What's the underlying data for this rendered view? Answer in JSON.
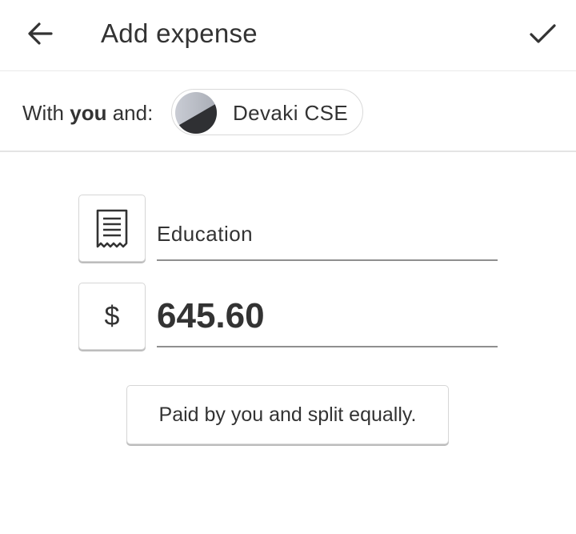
{
  "header": {
    "title": "Add expense",
    "back_icon": "arrow-left-icon",
    "save_icon": "check-icon"
  },
  "participants": {
    "label_prefix": "With",
    "label_you": "you",
    "label_suffix": "and:",
    "chip_name": "Devaki CSE"
  },
  "expense": {
    "category_icon": "receipt-icon",
    "description": "Education",
    "currency_symbol": "$",
    "amount": "645.60"
  },
  "split": {
    "label": "Paid by you and split equally."
  }
}
